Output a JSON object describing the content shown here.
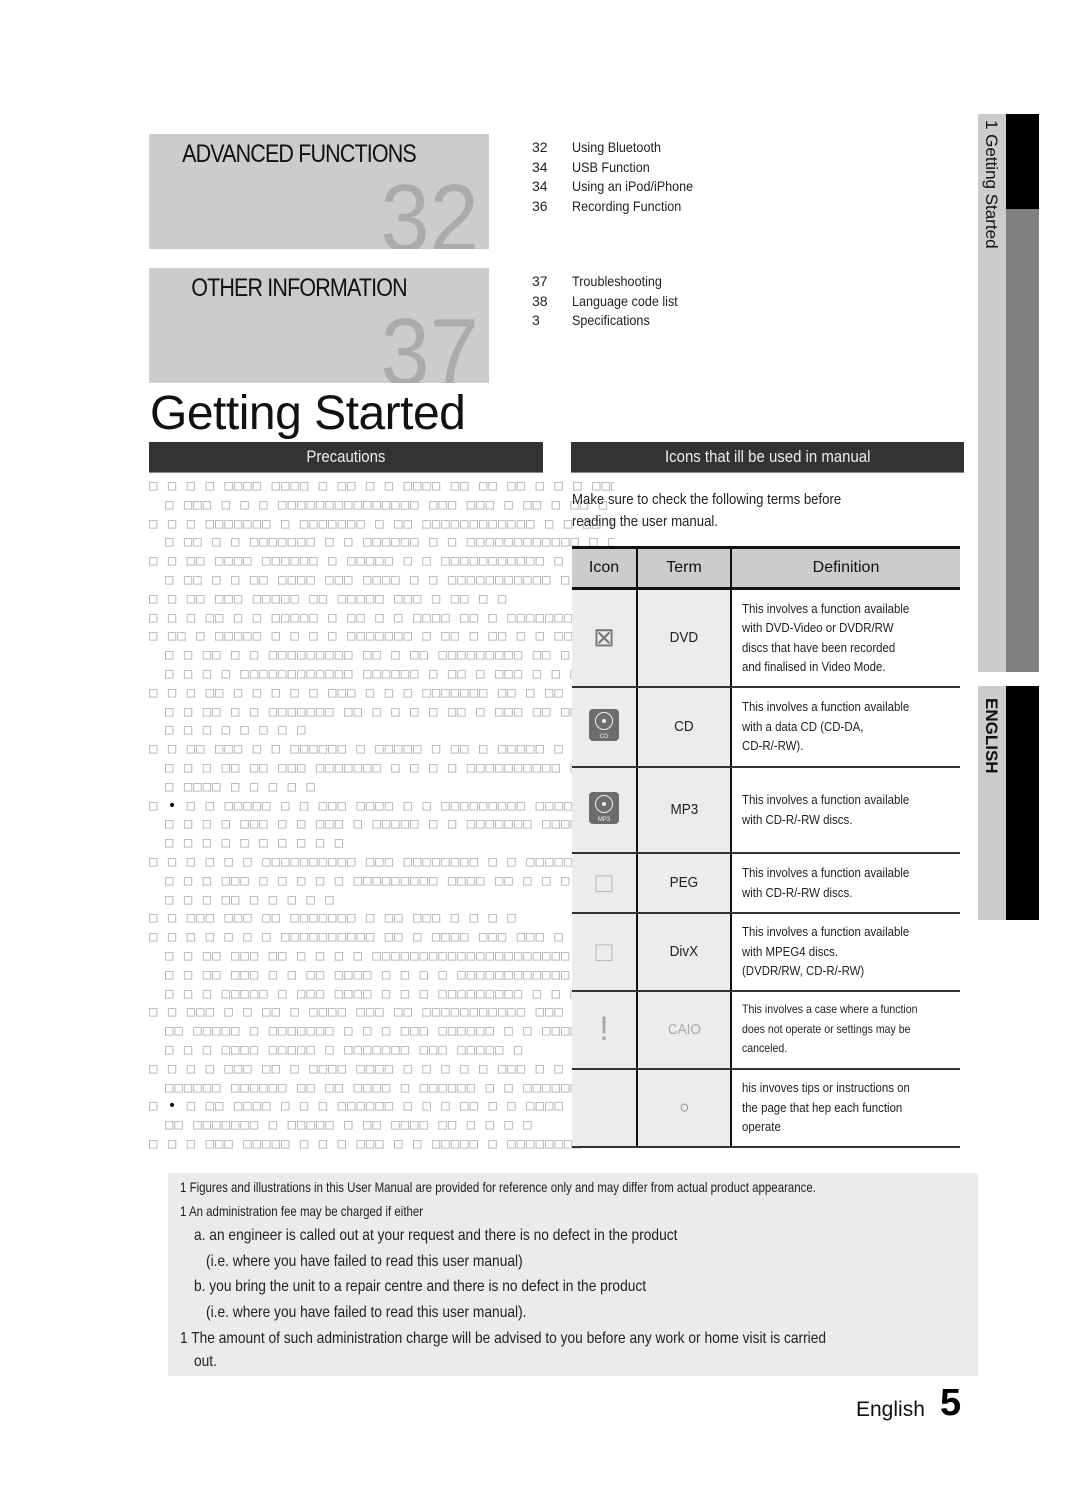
{
  "chapters": [
    {
      "title": "ADVANCED FUNCTIONS",
      "number": "32",
      "items": [
        {
          "page": "32",
          "label": "Using Bluetooth"
        },
        {
          "page": "34",
          "label": "USB Function"
        },
        {
          "page": "34",
          "label": "Using an iPod/iPhone"
        },
        {
          "page": "36",
          "label": "Recording Function"
        }
      ]
    },
    {
      "title": "OTHER INFORMATION",
      "number": "37",
      "items": [
        {
          "page": "37",
          "label": "Troubleshooting"
        },
        {
          "page": "38",
          "label": "Language code list"
        },
        {
          "page": "3",
          "label": "Specifications"
        }
      ]
    }
  ],
  "page_title": "Getting Started",
  "precautions": {
    "heading": "Precautions",
    "lines": [
      {
        "indent": false,
        "text": "□ □ □ □ □□□□ □□□□ □ □□ □ □ □□□□ □□ □□ □□ □ □ □ □□□□"
      },
      {
        "indent": true,
        "text": "□ □□□ □ □ □ □□□□□□□□□□□□□□□ □□□ □□□ □ □□ □ □□ □ □"
      },
      {
        "indent": false,
        "text": "□ □ □ □□□□□□□ □ □□□□□□□ □ □□ □□□□□□□□□□□□ □ □ □□ □"
      },
      {
        "indent": true,
        "text": "□ □□ □ □ □□□□□□□ □ □ □□□□□□ □ □ □□□□□□□□□□□□ □ □ □"
      },
      {
        "indent": false,
        "text": "□ □ □□ □□□□ □□□□□□ □ □□□□□ □ □ □□□□□□□□□□□ □ □□ □ □□□"
      },
      {
        "indent": true,
        "text": "□ □□ □ □ □□ □□□□ □□□ □□□□ □ □ □□□□□□□□□□□ □ □ □ □ □"
      },
      {
        "indent": false,
        "text": "□ □ □□ □□□ □□□□□ □□ □□□□□ □□□ □ □□ □ □"
      },
      {
        "indent": false,
        "text": "□ □ □ □□ □ □ □□□□□ □ □□ □ □ □□□□ □□ □ □□□□□□□ □ □ □ □"
      },
      {
        "indent": false,
        "text": "□ □□ □ □□□□□ □ □ □ □ □□□□□□□ □ □□ □ □□ □ □ □□ □□□□□"
      },
      {
        "indent": true,
        "text": "□ □ □□ □ □ □□□□□□□□□ □□ □ □□ □□□□□□□□□ □□ □ □□ □ □"
      },
      {
        "indent": true,
        "text": "□ □ □ □ □□□□□□□□□□□□ □□□□□□ □ □□ □ □□□ □ □ □"
      },
      {
        "indent": false,
        "text": "□ □ □ □□ □ □ □ □ □ □□□ □ □ □ □□□□□□□ □□ □ □□ □□□□□□ □"
      },
      {
        "indent": true,
        "text": "□ □ □□ □ □ □□□□□□□ □□ □ □ □ □ □□ □ □□□ □□ □□ □□□ □□"
      },
      {
        "indent": true,
        "text": "□ □ □ □ □ □ □ □"
      },
      {
        "indent": false,
        "text": "□ □ □□ □□□ □ □ □□□□□□ □ □□□□□ □ □□ □ □□□□□ □ □□□□□ □"
      },
      {
        "indent": true,
        "text": "□ □ □ □□ □□ □□□ □□□□□□□ □ □ □ □ □□□□□□□□□□ □ □□□□ □ □"
      },
      {
        "indent": true,
        "text": "□ □□□□ □ □ □ □ □"
      },
      {
        "indent": false,
        "text": "□ • □ □ □□□□□ □ □ □□□ □□□□ □ □ □□□□□□□□□ □□□□□□"
      },
      {
        "indent": true,
        "text": "□ □ □ □ □□□ □ □ □□□ □ □□□□□ □ □ □□□□□□□ □□□□□□□□□□ □"
      },
      {
        "indent": true,
        "text": "□ □ □ □ □ □ □ □ □ □"
      },
      {
        "indent": false,
        "text": "□ □ □ □ □ □ □□□□□□□□□□ □□□ □□□□□□□□ □ □ □□□□□"
      },
      {
        "indent": true,
        "text": "□ □ □ □□□ □ □ □ □ □ □□□□□□□□□ □□□□ □□ □ □ □ □□□□"
      },
      {
        "indent": true,
        "text": "□ □ □ □□ □ □ □ □ □"
      },
      {
        "indent": false,
        "text": "□ □ □□□ □□□ □□ □□□□□□□ □ □□ □□□ □ □ □ □"
      },
      {
        "indent": false,
        "text": "□ □ □ □ □ □ □ □□□□□□□□□□ □□ □ □□□□ □□□ □□□ □ □□ □"
      },
      {
        "indent": true,
        "text": "□ □ □□ □□□ □□ □ □ □ □ □□□□□□□□□□□□□□□□□□□□□ □ □"
      },
      {
        "indent": true,
        "text": "□ □ □□ □□□ □ □ □□ □□□□ □ □ □ □ □□□□□□□□□□□□ □□□"
      },
      {
        "indent": true,
        "text": "□ □ □ □□□□□ □ □□□ □□□□ □ □ □ □□□□□□□□□ □ □ □"
      },
      {
        "indent": false,
        "text": "□ □ □□□ □ □ □□ □ □□□□ □□□ □□ □□□□□□□□□□□ □□□ □ □ □"
      },
      {
        "indent": true,
        "text": "□□ □□□□□ □ □□□□□□□ □ □ □ □□□ □□□□□□ □ □ □□□□ □"
      },
      {
        "indent": true,
        "text": "□   □ □ □□□□ □□□□□ □ □□□□□□□ □□□ □□□□□ □"
      },
      {
        "indent": false,
        "text": "□ □ □ □ □□□ □□ □ □□□□ □□□□ □ □ □ □ □ □□□ □ □ □□□□□"
      },
      {
        "indent": true,
        "text": "□□□□□□ □□□□□□ □□ □□ □□□□ □ □□□□□□ □ □ □□□□□□□□□□□ □"
      },
      {
        "indent": false,
        "text": "□ • □ □□ □□□□ □ □ □ □□□□□□ □ □ □ □□ □ □ □□□□ □□□□□ □ □"
      },
      {
        "indent": true,
        "text": "□□ □□□□□□□ □ □□□□□ □ □□ □□□□ □□ □ □ □ □"
      },
      {
        "indent": false,
        "text": "□ □ □ □□□ □□□□□ □ □ □ □□□ □ □ □□□□□ □ □□□□□□□□"
      }
    ]
  },
  "icons_section": {
    "heading": "Icons that ill be used in manual",
    "intro_line1": "Make sure to check the following terms before",
    "intro_line2": "reading the user manual.",
    "columns": [
      "Icon",
      "Term",
      "Definition"
    ],
    "rows": [
      {
        "icon": "dvd-icon",
        "glyph": "⊠",
        "term": "DVD",
        "definition": [
          "This involves a function available",
          "with DVD-Video or DVDR/RW",
          "discs that have been recorded",
          "and finalised in Video Mode."
        ]
      },
      {
        "icon": "cd-icon",
        "glyph": "CD",
        "term": "CD",
        "definition": [
          "This involves a function available",
          "with a data CD (CD-DA,",
          "CD-R/-RW)."
        ]
      },
      {
        "icon": "mp3-icon",
        "glyph": "MP3",
        "term": "MP3",
        "definition": [
          "This involves a function available",
          "with CD-R/-RW discs."
        ]
      },
      {
        "icon": "jpeg-icon",
        "glyph": "□",
        "term": "PEG",
        "definition": [
          "This involves a function available",
          "with CD-R/-RW discs."
        ]
      },
      {
        "icon": "divx-icon",
        "glyph": "□",
        "term": "DivX",
        "definition": [
          "This involves a function available",
          "with MPEG4 discs.",
          "(DVDR/RW, CD-R/-RW)"
        ]
      },
      {
        "icon": "caution-icon",
        "glyph": "!",
        "term": "CAIO",
        "definition": [
          "This involves a case where a function",
          "does not operate or settings may be",
          "canceled."
        ]
      },
      {
        "icon": "note-icon",
        "glyph": "○",
        "term": "",
        "definition": [
          "his invoves tips or instructions on",
          "the page that hep each function",
          "operate"
        ]
      }
    ]
  },
  "notes": [
    "1 Figures and illustrations in this User Manual are provided for reference only and may differ from actual product appearance.",
    "1 An administration fee may be charged if either",
    "a. an engineer is called out at your request and there is no defect in the product",
    "(i.e. where you have failed to read this user manual)",
    "b. you bring the unit to a repair centre and there is no defect in the product",
    "(i.e. where you have failed to read this user manual).",
    "1 The amount of such administration charge will be advised to you before any work or home visit is carried",
    "out."
  ],
  "side_tabs": {
    "chapter": "1   Getting Started",
    "language": "ENGLISH"
  },
  "footer": {
    "language": "English",
    "page_number": "5"
  }
}
